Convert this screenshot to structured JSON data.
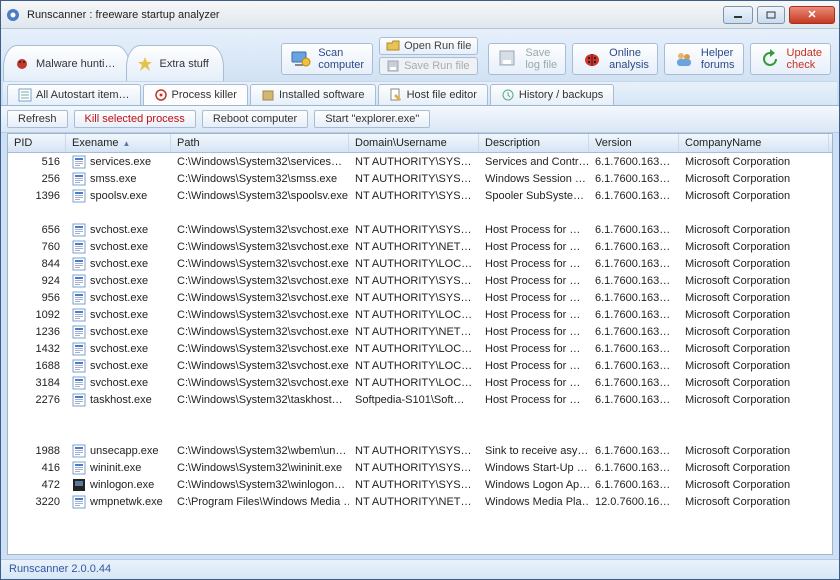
{
  "window": {
    "title": "Runscanner : freeware startup analyzer"
  },
  "big_tabs": [
    {
      "label": "Malware hunti…"
    },
    {
      "label": "Extra stuff"
    }
  ],
  "big_buttons": {
    "scan": {
      "line1": "Scan",
      "line2": "computer"
    },
    "open_run": "Open Run file",
    "save_run": "Save Run file",
    "save_log": {
      "line1": "Save",
      "line2": "log file"
    },
    "online": {
      "line1": "Online",
      "line2": "analysis"
    },
    "helper": {
      "line1": "Helper",
      "line2": "forums"
    },
    "update": {
      "line1": "Update",
      "line2": "check"
    }
  },
  "sub_tabs": [
    "All Autostart item…",
    "Process killer",
    "Installed software",
    "Host file editor",
    "History / backups"
  ],
  "toolbar": {
    "refresh": "Refresh",
    "kill": "Kill selected process",
    "reboot": "Reboot computer",
    "explorer": "Start \"explorer.exe\""
  },
  "columns": [
    "PID",
    "Exename",
    "Path",
    "Domain\\Username",
    "Description",
    "Version",
    "CompanyName"
  ],
  "rows": [
    {
      "pid": 516,
      "exe": "services.exe",
      "path": "C:\\Windows\\System32\\services…",
      "dom": "NT AUTHORITY\\SYS…",
      "desc": "Services and Contr…",
      "ver": "6.1.7600.163…",
      "comp": "Microsoft Corporation"
    },
    {
      "pid": 256,
      "exe": "smss.exe",
      "path": "C:\\Windows\\System32\\smss.exe",
      "dom": "NT AUTHORITY\\SYS…",
      "desc": "Windows Session …",
      "ver": "6.1.7600.163…",
      "comp": "Microsoft Corporation"
    },
    {
      "pid": 1396,
      "exe": "spoolsv.exe",
      "path": "C:\\Windows\\System32\\spoolsv.exe",
      "dom": "NT AUTHORITY\\SYS…",
      "desc": "Spooler SubSyste…",
      "ver": "6.1.7600.163…",
      "comp": "Microsoft Corporation"
    },
    null,
    {
      "pid": 656,
      "exe": "svchost.exe",
      "path": "C:\\Windows\\System32\\svchost.exe",
      "dom": "NT AUTHORITY\\SYS…",
      "desc": "Host Process for …",
      "ver": "6.1.7600.163…",
      "comp": "Microsoft Corporation"
    },
    {
      "pid": 760,
      "exe": "svchost.exe",
      "path": "C:\\Windows\\System32\\svchost.exe",
      "dom": "NT AUTHORITY\\NET…",
      "desc": "Host Process for …",
      "ver": "6.1.7600.163…",
      "comp": "Microsoft Corporation"
    },
    {
      "pid": 844,
      "exe": "svchost.exe",
      "path": "C:\\Windows\\System32\\svchost.exe",
      "dom": "NT AUTHORITY\\LOC…",
      "desc": "Host Process for …",
      "ver": "6.1.7600.163…",
      "comp": "Microsoft Corporation"
    },
    {
      "pid": 924,
      "exe": "svchost.exe",
      "path": "C:\\Windows\\System32\\svchost.exe",
      "dom": "NT AUTHORITY\\SYS…",
      "desc": "Host Process for …",
      "ver": "6.1.7600.163…",
      "comp": "Microsoft Corporation"
    },
    {
      "pid": 956,
      "exe": "svchost.exe",
      "path": "C:\\Windows\\System32\\svchost.exe",
      "dom": "NT AUTHORITY\\SYS…",
      "desc": "Host Process for …",
      "ver": "6.1.7600.163…",
      "comp": "Microsoft Corporation"
    },
    {
      "pid": 1092,
      "exe": "svchost.exe",
      "path": "C:\\Windows\\System32\\svchost.exe",
      "dom": "NT AUTHORITY\\LOC…",
      "desc": "Host Process for …",
      "ver": "6.1.7600.163…",
      "comp": "Microsoft Corporation"
    },
    {
      "pid": 1236,
      "exe": "svchost.exe",
      "path": "C:\\Windows\\System32\\svchost.exe",
      "dom": "NT AUTHORITY\\NET…",
      "desc": "Host Process for …",
      "ver": "6.1.7600.163…",
      "comp": "Microsoft Corporation"
    },
    {
      "pid": 1432,
      "exe": "svchost.exe",
      "path": "C:\\Windows\\System32\\svchost.exe",
      "dom": "NT AUTHORITY\\LOC…",
      "desc": "Host Process for …",
      "ver": "6.1.7600.163…",
      "comp": "Microsoft Corporation"
    },
    {
      "pid": 1688,
      "exe": "svchost.exe",
      "path": "C:\\Windows\\System32\\svchost.exe",
      "dom": "NT AUTHORITY\\LOC…",
      "desc": "Host Process for …",
      "ver": "6.1.7600.163…",
      "comp": "Microsoft Corporation"
    },
    {
      "pid": 3184,
      "exe": "svchost.exe",
      "path": "C:\\Windows\\System32\\svchost.exe",
      "dom": "NT AUTHORITY\\LOC…",
      "desc": "Host Process for …",
      "ver": "6.1.7600.163…",
      "comp": "Microsoft Corporation"
    },
    {
      "pid": 2276,
      "exe": "taskhost.exe",
      "path": "C:\\Windows\\System32\\taskhost…",
      "dom": "Softpedia-S101\\Soft…",
      "desc": "Host Process for …",
      "ver": "6.1.7600.163…",
      "comp": "Microsoft Corporation"
    },
    null,
    null,
    {
      "pid": 1988,
      "exe": "unsecapp.exe",
      "path": "C:\\Windows\\System32\\wbem\\un…",
      "dom": "NT AUTHORITY\\SYS…",
      "desc": "Sink to receive asy…",
      "ver": "6.1.7600.163…",
      "comp": "Microsoft Corporation"
    },
    {
      "pid": 416,
      "exe": "wininit.exe",
      "path": "C:\\Windows\\System32\\wininit.exe",
      "dom": "NT AUTHORITY\\SYS…",
      "desc": "Windows Start-Up …",
      "ver": "6.1.7600.163…",
      "comp": "Microsoft Corporation"
    },
    {
      "pid": 472,
      "exe": "winlogon.exe",
      "path": "C:\\Windows\\System32\\winlogon…",
      "dom": "NT AUTHORITY\\SYS…",
      "desc": "Windows Logon Ap…",
      "ver": "6.1.7600.163…",
      "comp": "Microsoft Corporation",
      "icon": "winlogon"
    },
    {
      "pid": 3220,
      "exe": "wmpnetwk.exe",
      "path": "C:\\Program Files\\Windows Media …",
      "dom": "NT AUTHORITY\\NET…",
      "desc": "Windows Media Pla…",
      "ver": "12.0.7600.16…",
      "comp": "Microsoft Corporation"
    }
  ],
  "status": "Runscanner 2.0.0.44"
}
